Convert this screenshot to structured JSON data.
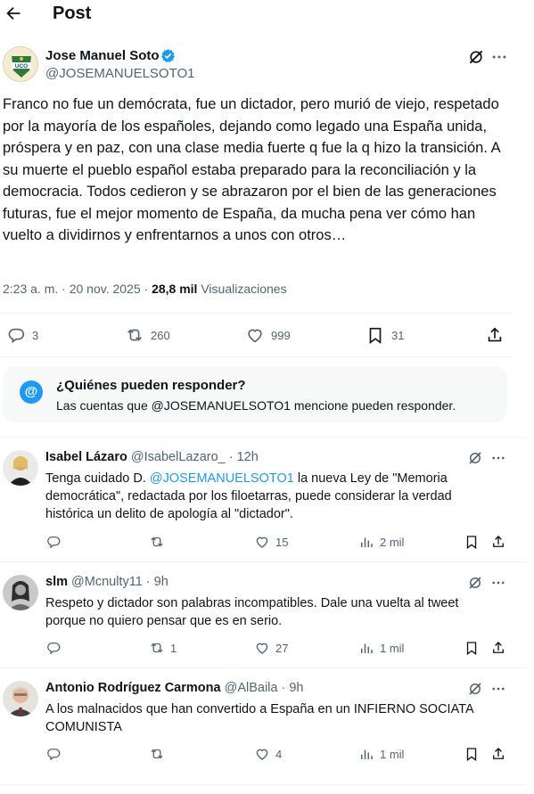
{
  "header": {
    "title": "Post",
    "back_icon": "arrow-left-icon"
  },
  "post": {
    "author_name": "Jose Manuel Soto",
    "handle": "@JOSEMANUELSOTO1",
    "avatar_text": "UCO",
    "verified": true,
    "text": "Franco no fue un demócrata, fue un dictador, pero murió de viejo, respetado por la mayoría de los españoles, dejando como legado una España unida, próspera y en paz, con una clase media fuerte q fue la q hizo la transición. A su muerte el pueblo español estaba preparado para la reconciliación y la democracia. Todos cedieron y se abrazaron por el bien de las generaciones futuras, fue el mejor momento de España, da mucha pena ver cómo han vuelto a dividirnos y enfrentarnos a unos con otros…",
    "timestamp": "2:23 a. m. · 20 nov. 2025",
    "sep": " · ",
    "views_count": "28,8 mil",
    "views_label": "Visualizaciones",
    "replies": "3",
    "reposts": "260",
    "likes": "999",
    "bookmarks": "31"
  },
  "reply_restriction": {
    "icon": "@",
    "title": "¿Quiénes pueden responder?",
    "description": "Las cuentas que @JOSEMANUELSOTO1 mencione pueden responder."
  },
  "replies": [
    {
      "name": "Isabel Lázaro",
      "handle": "@IsabelLazaro_",
      "sep": " · ",
      "time": "12h",
      "text_before": "Tenga cuidado D. ",
      "mention": "@JOSEMANUELSOTO1",
      "text_after": " la nueva Ley de \"Memoria democrática\", redactada por los filoetarras, puede considerar la verdad histórica un delito de apología al \"dictador\".",
      "replies": "",
      "reposts": "",
      "likes": "15",
      "views": "2 mil"
    },
    {
      "name": "slm",
      "handle": "@Mcnulty11",
      "sep": " · ",
      "time": "9h",
      "text": "Respeto y dictador son palabras incompatibles. Dale una vuelta al tweet porque no quiero pensar que es en serio.",
      "replies": "",
      "reposts": "1",
      "likes": "27",
      "views": "1 mil"
    },
    {
      "name": "Antonio Rodríguez Carmona",
      "handle": "@AlBaila",
      "sep": " · ",
      "time": "9h",
      "text": "A los malnacidos que han convertido a España en un INFIERNO SOCIATA COMUNISTA",
      "replies": "",
      "reposts": "",
      "likes": "4",
      "views": "1 mil"
    }
  ],
  "colors": {
    "accent": "#1d9bf0",
    "text": "#0f1419",
    "muted": "#536471",
    "divider": "#eff3f4",
    "panel": "#f7f9f9"
  }
}
